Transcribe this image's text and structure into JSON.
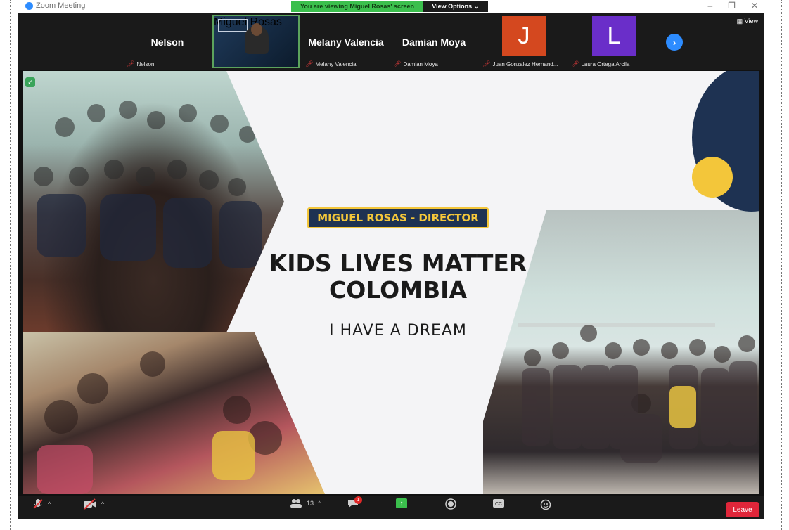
{
  "window": {
    "app_title": "Zoom Meeting",
    "viewing_banner": "You are viewing Miguel Rosas' screen",
    "view_options": "View Options",
    "controls": [
      "–",
      "❐",
      "✕"
    ]
  },
  "participants": {
    "view_label": "View",
    "tiles": [
      {
        "big_name": "Nelson",
        "label": "Nelson"
      },
      {
        "label": "Miguel Rosas",
        "video": true
      },
      {
        "big_name": "Melany Valencia",
        "label": "Melany Valencia"
      },
      {
        "big_name": "Damian Moya",
        "label": "Damian Moya"
      },
      {
        "initial": "J",
        "label": "Juan Gonzalez Hernand...",
        "color": "#d4481f"
      },
      {
        "initial": "L",
        "label": "Laura Ortega Arcila",
        "color": "#6a2ec9"
      }
    ]
  },
  "slide": {
    "subtitle": "MIGUEL ROSAS - DIRECTOR",
    "headline_line1": "KIDS LIVES MATTER",
    "headline_line2": "COLOMBIA",
    "tagline": "I HAVE A DREAM"
  },
  "toolbar": {
    "participant_count": "13",
    "chat_badge": "1",
    "leave_label": "Leave",
    "items": [
      "mute-icon",
      "stop-video-icon",
      "participants-icon",
      "chat-icon",
      "share-screen-icon",
      "record-icon",
      "live-transcript-icon",
      "reactions-icon"
    ]
  },
  "colors": {
    "navy": "#1e3252",
    "yellow": "#f3c63a",
    "leave_red": "#e0263a",
    "share_green": "#3bbf4d",
    "zoom_blue": "#2d8cff"
  }
}
